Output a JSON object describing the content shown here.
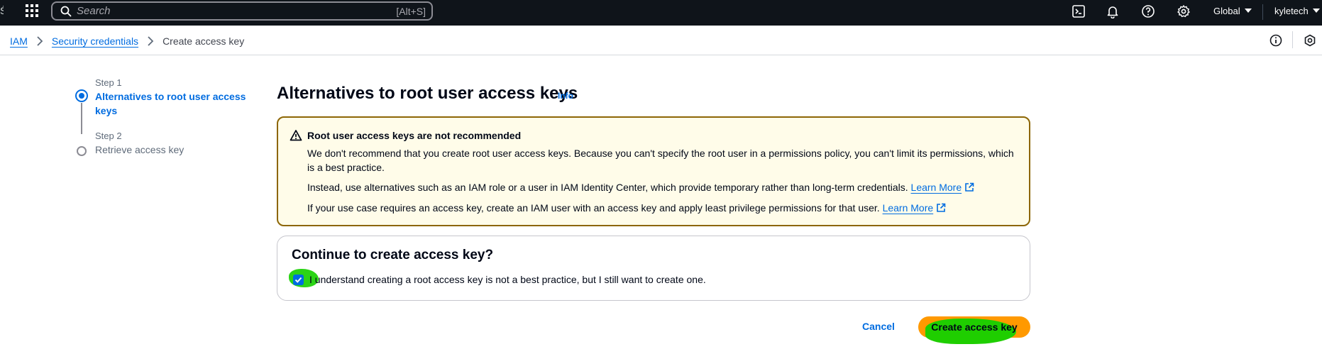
{
  "topbar": {
    "search_placeholder": "Search",
    "search_shortcut": "[Alt+S]",
    "region": "Global",
    "account": "kyletech",
    "icons": [
      "grid-icon",
      "search-icon",
      "cloudshell-icon",
      "bell-icon",
      "help-icon",
      "gear-icon"
    ]
  },
  "breadcrumb": {
    "items": [
      "IAM",
      "Security credentials"
    ],
    "current": "Create access key"
  },
  "steps": [
    {
      "label": "Step 1",
      "title": "Alternatives to root user access keys",
      "state": "active"
    },
    {
      "label": "Step 2",
      "title": "Retrieve access key",
      "state": "inactive"
    }
  ],
  "main": {
    "title": "Alternatives to root user access keys",
    "info": "Info"
  },
  "alert": {
    "title": "Root user access keys are not recommended",
    "p1": "We don't recommend that you create root user access keys. Because you can't specify the root user in a permissions policy, you can't limit its permissions, which is a best practice.",
    "p2": "Instead, use alternatives such as an IAM role or a user in IAM Identity Center, which provide temporary rather than long-term credentials.",
    "p3": "If your use case requires an access key, create an IAM user with an access key and apply least privilege permissions for that user.",
    "learn_more": "Learn More"
  },
  "confirm": {
    "title": "Continue to create access key?",
    "checkbox_label": "I understand creating a root access key is not a best practice, but I still want to create one.",
    "checked": true
  },
  "actions": {
    "cancel": "Cancel",
    "create": "Create access key"
  },
  "colors": {
    "accent": "#006ce0",
    "primary_button": "#ff9900",
    "warning_border": "#8d6605",
    "warning_bg": "#fffce9",
    "highlight": "#20d20a"
  }
}
